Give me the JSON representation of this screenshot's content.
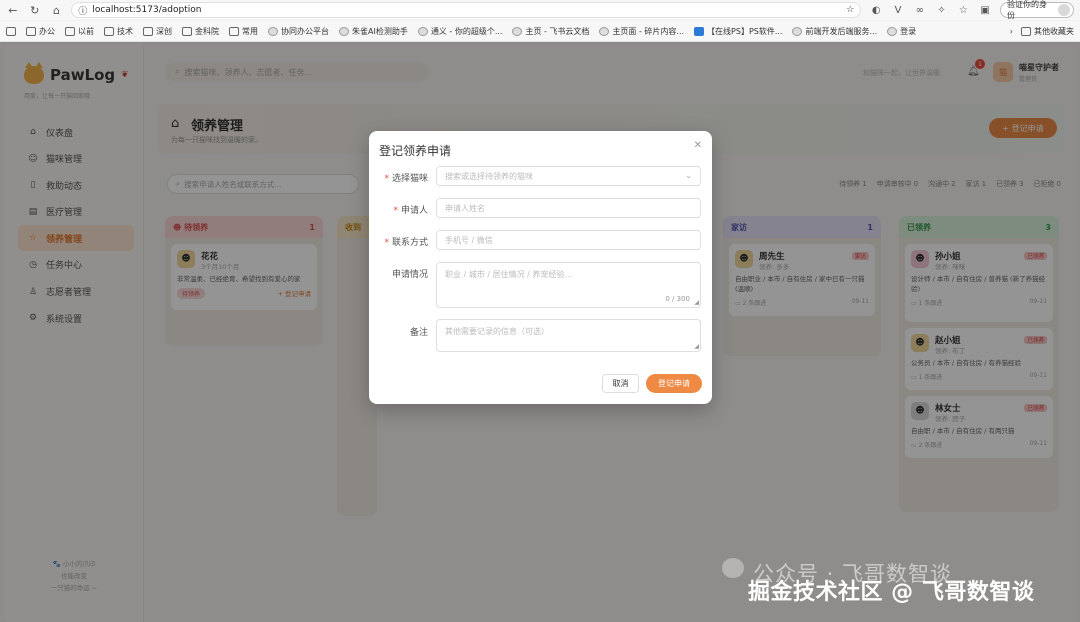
{
  "browser": {
    "url": "localhost:5173/adoption",
    "profile_label": "验证你的身份",
    "bookmarks": [
      "办公",
      "以前",
      "技术",
      "深创",
      "金科院",
      "常用",
      "协同办公平台",
      "朱雀AI检测助手",
      "通义 - 你的超级个...",
      "主页 - 飞书云文档",
      "主页面 - 碎片内容...",
      "【在线PS】PS软件...",
      "前端开发后端服务...",
      "登录"
    ],
    "other_bookmarks": "其他收藏夹"
  },
  "sidebar": {
    "logo": "PawLog",
    "logo_sub": "用爱，让每一只猫回家哦",
    "items": [
      {
        "label": "仪表盘",
        "icon": "home-icon"
      },
      {
        "label": "猫咪管理",
        "icon": "cat-icon"
      },
      {
        "label": "救助动态",
        "icon": "document-icon"
      },
      {
        "label": "医疗管理",
        "icon": "medical-icon"
      },
      {
        "label": "领养管理",
        "icon": "star-icon",
        "active": true
      },
      {
        "label": "任务中心",
        "icon": "clock-icon"
      },
      {
        "label": "志愿者管理",
        "icon": "user-icon"
      },
      {
        "label": "系统设置",
        "icon": "gear-icon"
      }
    ],
    "footer": [
      "🐾 小小的爪印",
      "也能改变",
      "一只猫的命运 ~"
    ]
  },
  "topbar": {
    "search_placeholder": "搜索猫咪、领养人、志愿者、任务...",
    "hint": "和猫咪一起，让世界温暖",
    "notification_count": "1",
    "user_avatar": "猫",
    "user_name": "喵星守护者",
    "user_role": "管理员"
  },
  "page": {
    "title": "领养管理",
    "subtitle": "为每一只猫咪找到温暖的家。",
    "add_button": "+ 登记申请",
    "filter_placeholder": "搜索申请人姓名或联系方式...",
    "stats": [
      {
        "label": "待领养",
        "value": "1"
      },
      {
        "label": "申请审核中",
        "value": "0"
      },
      {
        "label": "沟通中",
        "value": "2"
      },
      {
        "label": "家访",
        "value": "1"
      },
      {
        "label": "已领养",
        "value": "3"
      },
      {
        "label": "已拒绝",
        "value": "0"
      }
    ]
  },
  "board": {
    "col1": {
      "title": "待领养",
      "count": "1",
      "card": {
        "name": "花花",
        "meta": "3个月10个月",
        "desc": "非常温柔、已经绝育、希望找到有爱心的家",
        "pill": "待领养",
        "action": "+ 登记申请"
      }
    },
    "col2": {
      "title": "收到"
    },
    "col_visit": {
      "title": "家访",
      "count": "1",
      "card": {
        "name": "周先生",
        "meta": "领养: 多多",
        "tag": "家访",
        "desc": "自由职业 / 本市 / 自有住房 / 家中已有一只猫 (温顺)",
        "note": "2 条跟进",
        "date": "09-11"
      }
    },
    "col_done": {
      "title": "已领养",
      "count": "3",
      "cards": [
        {
          "name": "孙小姐",
          "meta": "领养: 咪咪",
          "tag": "已领养",
          "desc": "设计师 / 本市 / 自有住房 / 曾养猫 (新了养猫经验)",
          "note": "1 条跟进",
          "date": "09-11"
        },
        {
          "name": "赵小姐",
          "meta": "领养: 布丁",
          "tag": "已领养",
          "desc": "公务员 / 本市 / 自有住房 / 有养猫经验",
          "note": "1 条跟进",
          "date": "09-11"
        },
        {
          "name": "林女士",
          "meta": "领养: 团子",
          "tag": "已领养",
          "desc": "自由职 / 本市 / 自有住房 / 有两只猫",
          "note": "2 条跟进",
          "date": "09-11"
        }
      ]
    }
  },
  "modal": {
    "title": "登记领养申请",
    "fields": [
      {
        "label": "选择猫咪",
        "required": true,
        "placeholder": "搜索或选择待领养的猫咪"
      },
      {
        "label": "申请人",
        "required": true,
        "placeholder": "申请人姓名"
      },
      {
        "label": "联系方式",
        "required": true,
        "placeholder": "手机号 / 微信"
      },
      {
        "label": "申请情况",
        "required": false,
        "placeholder": "职业 / 城市 / 居住情况 / 养宠经验...",
        "counter": "0 / 300"
      },
      {
        "label": "备注",
        "required": false,
        "placeholder": "其他需要记录的信息（可选）"
      }
    ],
    "cancel": "取消",
    "submit": "登记申请"
  },
  "watermark": {
    "line1": "公众号 · 飞哥数智谈",
    "line2": "掘金技术社区 @ 飞哥数智谈"
  }
}
